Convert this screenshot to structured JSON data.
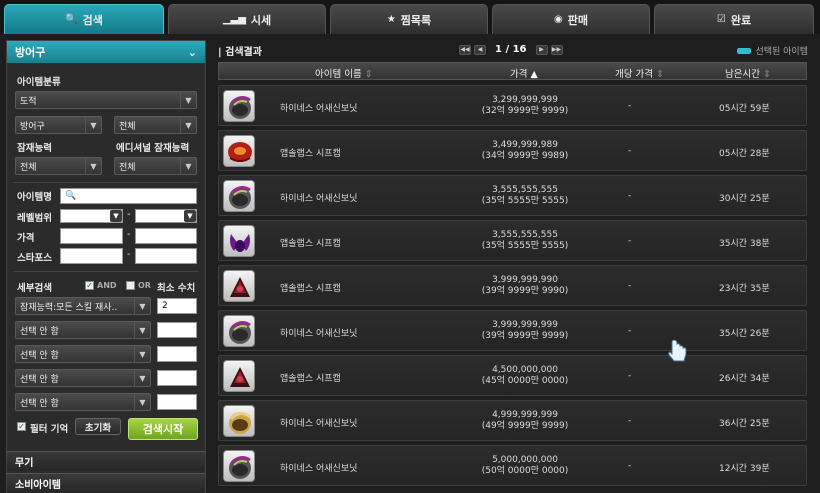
{
  "tabs": [
    {
      "label": "검색",
      "icon": "search-icon"
    },
    {
      "label": "시세",
      "icon": "bar-chart-icon"
    },
    {
      "label": "찜목록",
      "icon": "star-icon"
    },
    {
      "label": "판매",
      "icon": "coin-icon"
    },
    {
      "label": "완료",
      "icon": "checkbox-icon"
    }
  ],
  "sidebar": {
    "header": "방어구",
    "item_category_label": "아이템분류",
    "job_value": "도적",
    "slot_value": "방어구",
    "sub_value": "전체",
    "potential_label": "잠재능력",
    "additional_label": "에디셔널 잠재능력",
    "potential_value": "전체",
    "additional_value": "전체",
    "item_name_label": "아이템명",
    "level_label": "레벨범위",
    "price_label": "가격",
    "starforce_label": "스타포스",
    "range_sep": "-",
    "detail_label": "세부검색",
    "and_label": "AND",
    "or_label": "OR",
    "min_label": "최소 수치",
    "options": [
      {
        "label": "잠재능력:모든 스킬 재사..",
        "value": "2"
      },
      {
        "label": "선택 안 함",
        "value": ""
      },
      {
        "label": "선택 안 함",
        "value": ""
      },
      {
        "label": "선택 안 함",
        "value": ""
      },
      {
        "label": "선택 안 함",
        "value": ""
      }
    ],
    "filter_memory_label": "필터 기억",
    "reset_label": "초기화",
    "search_label": "검색시작",
    "categories": [
      "무기",
      "소비아이템"
    ]
  },
  "results": {
    "title": "검색결과",
    "page": "1 / 16",
    "selected_legend": "선택된 아이템",
    "columns": {
      "name": "아이템 이름",
      "price": "가격",
      "unit": "개당 가격",
      "time": "남은시간"
    },
    "rows": [
      {
        "name": "하이네스 어새신보닛",
        "price": "3,299,999,999",
        "price_kr": "(32억 9999만 9999)",
        "unit": "-",
        "time": "05시간 59분",
        "icon": "helmet-gray-icon"
      },
      {
        "name": "앱솔랩스 시프캡",
        "price": "3,499,999,989",
        "price_kr": "(34억 9999만 9989)",
        "unit": "-",
        "time": "05시간 28분",
        "icon": "cap-red-icon"
      },
      {
        "name": "하이네스 어새신보닛",
        "price": "3,555,555,555",
        "price_kr": "(35억 5555만 5555)",
        "unit": "-",
        "time": "30시간 25분",
        "icon": "helmet-gray-icon"
      },
      {
        "name": "앱솔랩스 시프캡",
        "price": "3,555,555,555",
        "price_kr": "(35억 5555만 5555)",
        "unit": "-",
        "time": "35시간 38분",
        "icon": "cap-purple-icon"
      },
      {
        "name": "앱솔랩스 시프캡",
        "price": "3,999,999,990",
        "price_kr": "(39억 9999만 9990)",
        "unit": "-",
        "time": "23시간 35분",
        "icon": "cap-dark-icon"
      },
      {
        "name": "하이네스 어새신보닛",
        "price": "3,999,999,999",
        "price_kr": "(39억 9999만 9999)",
        "unit": "-",
        "time": "35시간 26분",
        "icon": "helmet-gray-icon"
      },
      {
        "name": "앱솔랩스 시프캡",
        "price": "4,500,000,000",
        "price_kr": "(45억 0000만 0000)",
        "unit": "-",
        "time": "26시간 34분",
        "icon": "cap-dark-icon"
      },
      {
        "name": "하이네스 어새신보닛",
        "price": "4,999,999,999",
        "price_kr": "(49억 9999만 9999)",
        "unit": "-",
        "time": "36시간 25분",
        "icon": "helmet-gold-icon"
      },
      {
        "name": "하이네스 어새신보닛",
        "price": "5,000,000,000",
        "price_kr": "(50억 0000만 0000)",
        "unit": "-",
        "time": "12시간 39분",
        "icon": "helmet-gray-icon"
      }
    ]
  }
}
